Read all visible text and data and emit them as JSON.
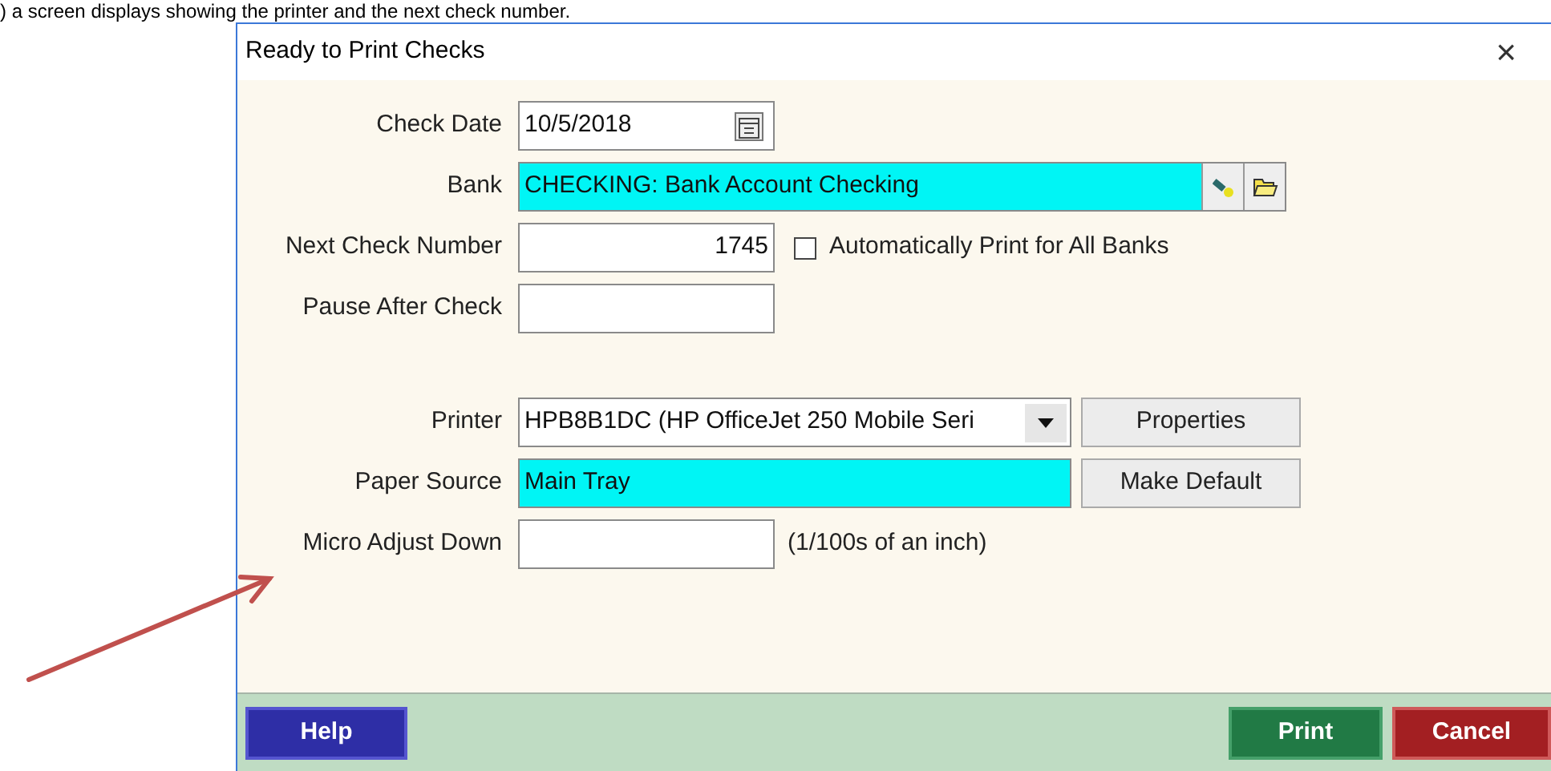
{
  "caption": ") a screen displays showing the printer and the next check number.",
  "window": {
    "title": "Ready to Print Checks",
    "close": "×"
  },
  "fields": [
    {
      "kind": "date",
      "label": "Check Date",
      "value": "10/5/2018",
      "highlighted": false
    },
    {
      "kind": "lookup",
      "label": "Bank",
      "value": "CHECKING: Bank Account Checking",
      "highlighted": true
    },
    {
      "kind": "number",
      "label": "Next Check Number",
      "value": "1745",
      "highlighted": false,
      "checkbox": {
        "label": "Automatically Print for All Banks",
        "checked": false
      }
    },
    {
      "kind": "text",
      "label": "Pause After Check",
      "highlighted": false
    },
    {
      "kind": "gap"
    },
    {
      "kind": "dropdown",
      "label": "Printer",
      "value": "HPB8B1DC (HP OfficeJet 250 Mobile Seri",
      "highlighted": false,
      "button": "Properties"
    },
    {
      "kind": "wide",
      "label": "Paper Source",
      "value": "Main Tray",
      "highlighted": true,
      "button": "Make Default"
    },
    {
      "kind": "text",
      "label": "Micro Adjust Down",
      "highlighted": false,
      "hint": "(1/100s of an inch)"
    }
  ],
  "footer": {
    "help": "Help",
    "print": "Print",
    "cancel": "Cancel"
  }
}
